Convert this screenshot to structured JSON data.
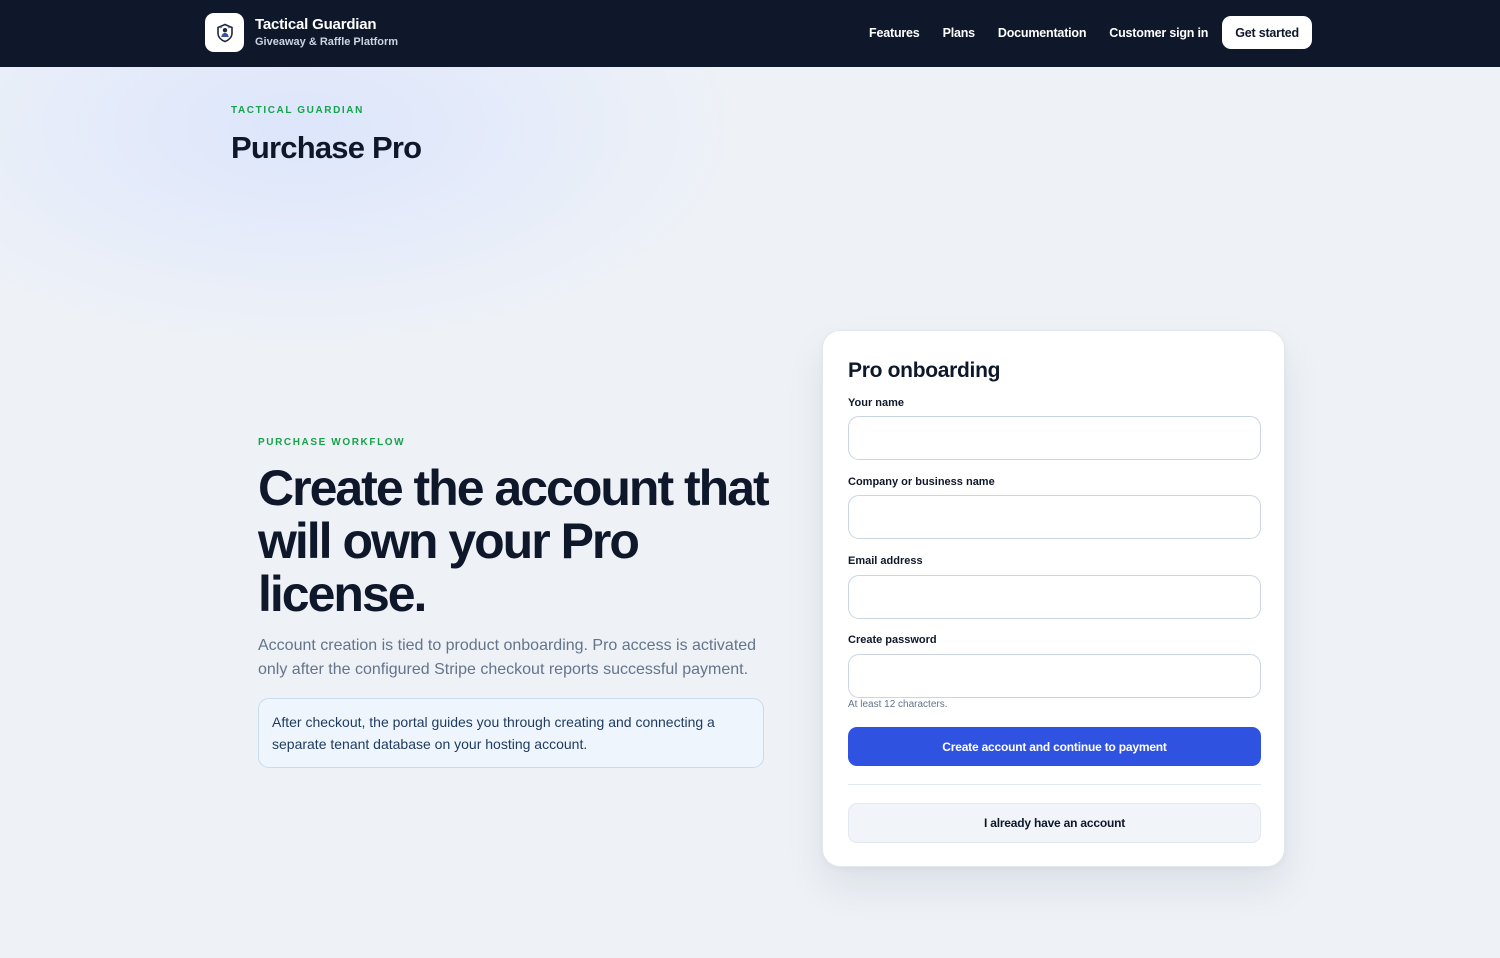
{
  "brand": {
    "name": "Tactical Guardian",
    "tagline": "Giveaway & Raffle Platform",
    "logo_icon": "shield-figure-icon"
  },
  "nav": {
    "links": [
      "Features",
      "Plans",
      "Documentation",
      "Customer sign in"
    ],
    "cta": "Get started"
  },
  "page": {
    "eyebrow": "TACTICAL GUARDIAN",
    "title": "Purchase Pro"
  },
  "hero": {
    "eyebrow": "PURCHASE WORKFLOW",
    "title": "Create the account that will own your Pro license.",
    "description": "Account creation is tied to product onboarding. Pro access is activated only after the configured Stripe checkout reports successful payment.",
    "note": "After checkout, the portal guides you through creating and connecting a separate tenant database on your hosting account."
  },
  "form": {
    "title": "Pro onboarding",
    "fields": [
      {
        "label": "Your name",
        "value": ""
      },
      {
        "label": "Company or business name",
        "value": ""
      },
      {
        "label": "Email address",
        "value": ""
      },
      {
        "label": "Create password",
        "value": ""
      }
    ],
    "password_hint": "At least 12 characters.",
    "submit_label": "Create account and continue to payment",
    "secondary_label": "I already have an account"
  },
  "colors": {
    "header_bg": "#0f172a",
    "accent_green": "#16a34a",
    "primary_blue": "#2f52e0",
    "page_bg": "#eef2f7"
  }
}
